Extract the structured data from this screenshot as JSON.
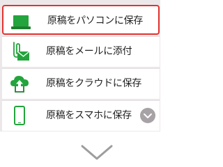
{
  "menu": {
    "items": [
      {
        "label": "原稿をパソコンに保存",
        "icon": "laptop-icon",
        "selected": true
      },
      {
        "label": "原稿をメールに添付",
        "icon": "mail-attachment-icon",
        "selected": false
      },
      {
        "label": "原稿をクラウドに保存",
        "icon": "cloud-upload-icon",
        "selected": false
      },
      {
        "label": "原稿をスマホに保存",
        "icon": "smartphone-icon",
        "selected": false
      }
    ],
    "more_icon": "chevron-down-circle-icon"
  },
  "footer": {
    "expand_icon": "chevron-down-icon"
  },
  "colors": {
    "accent_green": "#23a43c",
    "selected_border": "#e2322f",
    "menu_background": "#ece8ea",
    "more_button": "#a6a2a5"
  }
}
